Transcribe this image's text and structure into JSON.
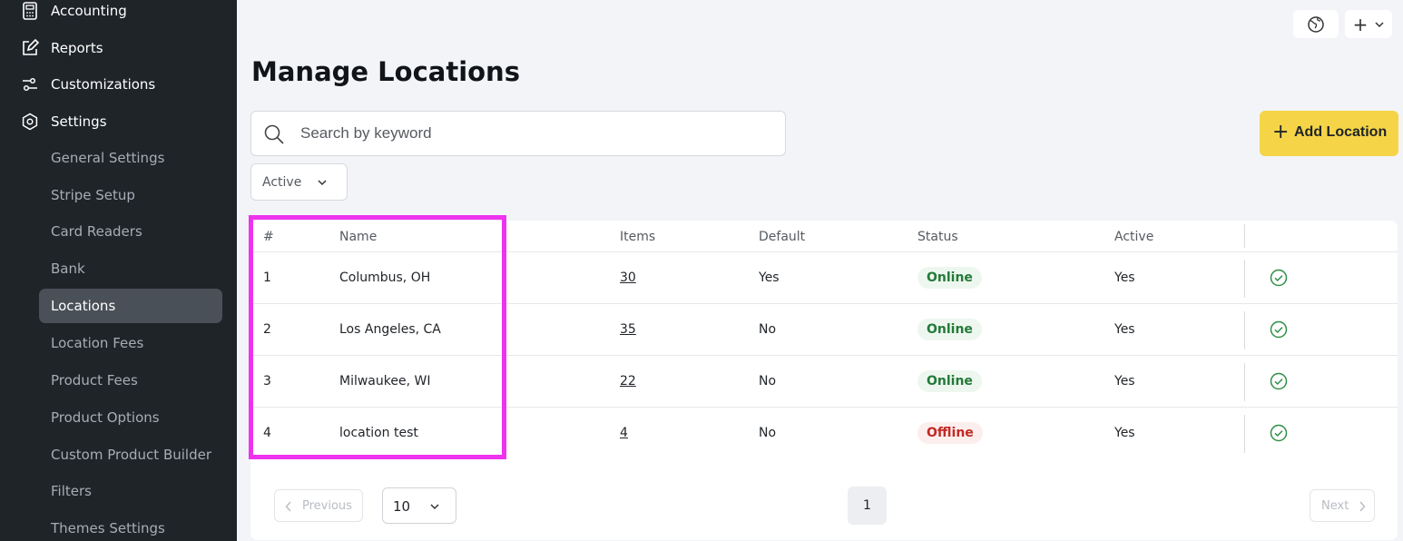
{
  "sidebar": {
    "top_items": [
      {
        "label": "Accounting",
        "icon": "calculator-icon"
      },
      {
        "label": "Reports",
        "icon": "edit-report-icon"
      },
      {
        "label": "Customizations",
        "icon": "sliders-icon"
      },
      {
        "label": "Settings",
        "icon": "gear-icon"
      }
    ],
    "settings_items": [
      "General Settings",
      "Stripe Setup",
      "Card Readers",
      "Bank",
      "Locations",
      "Location Fees",
      "Product Fees",
      "Product Options",
      "Custom Product Builder",
      "Filters",
      "Themes Settings"
    ],
    "active_item": "Locations"
  },
  "header": {
    "globe_icon": "globe-icon",
    "add_menu_plus": "+"
  },
  "page": {
    "title": "Manage Locations",
    "search_placeholder": "Search by keyword",
    "add_button_label": "Add Location",
    "filter_value": "Active"
  },
  "table": {
    "columns": [
      "#",
      "Name",
      "Items",
      "Default",
      "Status",
      "Active"
    ],
    "rows": [
      {
        "num": "1",
        "name": "Columbus, OH",
        "items": "30",
        "default": "Yes",
        "status": "Online",
        "active": "Yes"
      },
      {
        "num": "2",
        "name": "Los Angeles, CA",
        "items": "35",
        "default": "No",
        "status": "Online",
        "active": "Yes"
      },
      {
        "num": "3",
        "name": "Milwaukee, WI",
        "items": "22",
        "default": "No",
        "status": "Online",
        "active": "Yes"
      },
      {
        "num": "4",
        "name": "location test",
        "items": "4",
        "default": "No",
        "status": "Offline",
        "active": "Yes"
      }
    ]
  },
  "pagination": {
    "previous_label": "Previous",
    "page_size": "10",
    "current_page": "1",
    "next_label": "Next"
  },
  "colors": {
    "sidebar_bg": "#1f2429",
    "accent_yellow": "#f5d547",
    "online_green": "#237a38",
    "offline_red": "#c02a25",
    "highlight_magenta": "#ee33ee"
  }
}
